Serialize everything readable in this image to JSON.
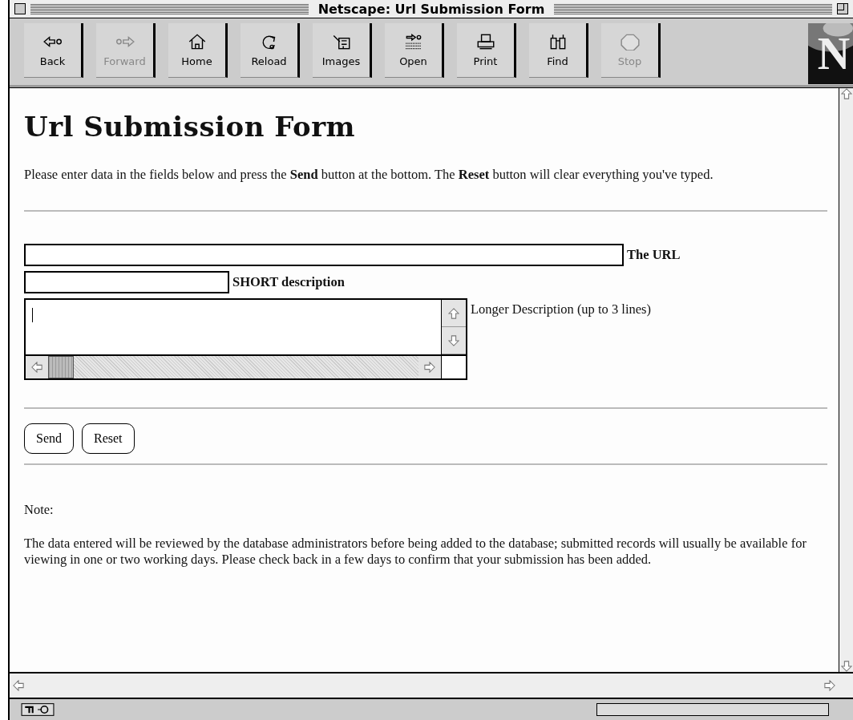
{
  "window": {
    "title": "Netscape: Url Submission Form"
  },
  "toolbar": {
    "buttons": [
      {
        "label": "Back",
        "disabled": false
      },
      {
        "label": "Forward",
        "disabled": true
      },
      {
        "label": "Home",
        "disabled": false
      },
      {
        "label": "Reload",
        "disabled": false
      },
      {
        "label": "Images",
        "disabled": false
      },
      {
        "label": "Open",
        "disabled": false
      },
      {
        "label": "Print",
        "disabled": false
      },
      {
        "label": "Find",
        "disabled": false
      },
      {
        "label": "Stop",
        "disabled": true
      }
    ],
    "logo": "N"
  },
  "page": {
    "heading": "Url Submission Form",
    "intro": "Please enter data in the fields below and press the **Send** button at the bottom. The **Reset** button will clear everything you've typed.",
    "fields": [
      {
        "kind": "wide",
        "label": "The URL",
        "emphasis": true
      },
      {
        "kind": "narrow",
        "label": "SHORT description",
        "emphasis": true
      },
      {
        "kind": "area",
        "label": "Longer Description (up to 3 lines)",
        "emphasis": false
      }
    ],
    "buttons": [
      "Send",
      "Reset"
    ],
    "note_title": "Note:",
    "note": "The data entered will be reviewed by the database administrators before being added to the database; submitted records will usually be available for viewing in one or two working days. Please check back in a few days to confirm that your submission has been added."
  }
}
